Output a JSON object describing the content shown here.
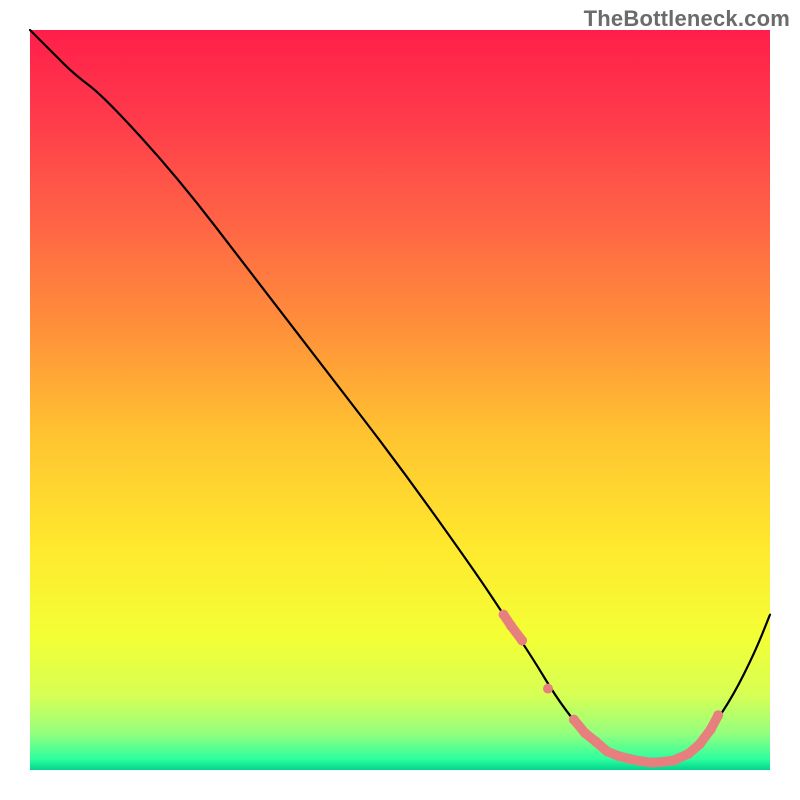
{
  "watermark": "TheBottleneck.com",
  "chart_data": {
    "type": "line",
    "title": "",
    "xlabel": "",
    "ylabel": "",
    "xlim": [
      0,
      100
    ],
    "ylim": [
      0,
      100
    ],
    "grid": false,
    "legend": false,
    "background_gradient": {
      "direction": "vertical",
      "stops": [
        {
          "offset": 0.0,
          "color": "#ff1e4a"
        },
        {
          "offset": 0.12,
          "color": "#ff3b4b"
        },
        {
          "offset": 0.25,
          "color": "#ff6146"
        },
        {
          "offset": 0.4,
          "color": "#ff8f3a"
        },
        {
          "offset": 0.55,
          "color": "#ffc430"
        },
        {
          "offset": 0.7,
          "color": "#ffe92e"
        },
        {
          "offset": 0.82,
          "color": "#f3ff35"
        },
        {
          "offset": 0.9,
          "color": "#d6ff55"
        },
        {
          "offset": 0.95,
          "color": "#95ff7d"
        },
        {
          "offset": 0.985,
          "color": "#2eff9f"
        },
        {
          "offset": 1.0,
          "color": "#01d58c"
        }
      ]
    },
    "series": [
      {
        "name": "bottleneck-curve",
        "color": "#000000",
        "x": [
          0,
          3,
          6,
          10,
          20,
          30,
          40,
          50,
          60,
          64,
          68,
          71,
          74,
          76,
          78,
          80,
          82,
          84,
          86,
          88,
          90,
          92,
          95,
          98,
          100
        ],
        "y": [
          100,
          97,
          94,
          91,
          80,
          67,
          54,
          41,
          27,
          21,
          15,
          10,
          6,
          4,
          2.5,
          1.6,
          1.2,
          1.0,
          1.2,
          1.8,
          3.2,
          5.5,
          10,
          16,
          21
        ]
      }
    ],
    "markers": {
      "name": "highlight-dots",
      "color": "#e77f7f",
      "radius": 5,
      "x": [
        64,
        65,
        66.5,
        70,
        73.5,
        75,
        76.5,
        78,
        79.5,
        81,
        82.5,
        84,
        85.5,
        87,
        89,
        90.5,
        92,
        93
      ],
      "y": [
        21,
        19.5,
        17.5,
        11,
        6.8,
        5.0,
        3.8,
        2.5,
        1.9,
        1.5,
        1.2,
        1.0,
        1.1,
        1.3,
        2.2,
        3.5,
        5.5,
        7.4
      ]
    }
  }
}
